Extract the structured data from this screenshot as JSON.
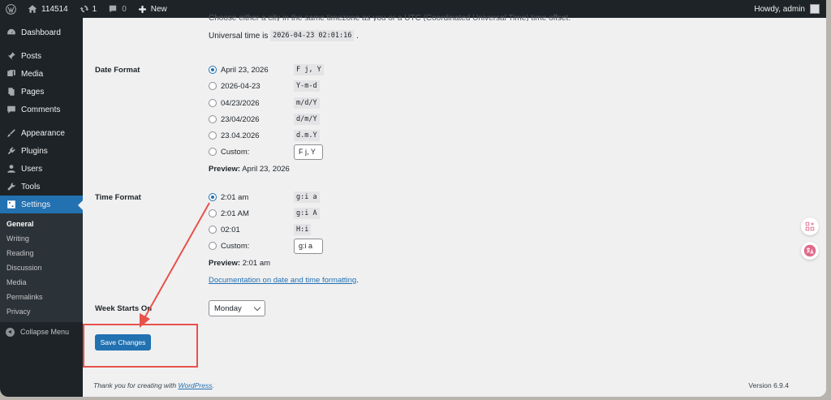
{
  "admin_bar": {
    "site_name": "114514",
    "updates_count": "1",
    "comments_count": "0",
    "new_label": "New",
    "greeting": "Howdy, admin"
  },
  "sidebar": {
    "items": [
      {
        "label": "Dashboard",
        "icon": "dashboard-icon"
      },
      {
        "label": "Posts",
        "icon": "pin-icon"
      },
      {
        "label": "Media",
        "icon": "media-icon"
      },
      {
        "label": "Pages",
        "icon": "page-icon"
      },
      {
        "label": "Comments",
        "icon": "comment-icon"
      },
      {
        "label": "Appearance",
        "icon": "brush-icon"
      },
      {
        "label": "Plugins",
        "icon": "plugin-icon"
      },
      {
        "label": "Users",
        "icon": "user-icon"
      },
      {
        "label": "Tools",
        "icon": "wrench-icon"
      },
      {
        "label": "Settings",
        "icon": "settings-icon"
      }
    ],
    "submenu": [
      "General",
      "Writing",
      "Reading",
      "Discussion",
      "Media",
      "Permalinks",
      "Privacy"
    ],
    "collapse_label": "Collapse Menu"
  },
  "timezone": {
    "clipped_text": "Choose either a city in the same timezone as you or a UTC (Coordinated Universal Time) time offset.",
    "universal_prefix": "Universal time is",
    "universal_value": "2026-04-23 02:01:16",
    "universal_suffix": "."
  },
  "date_format": {
    "label": "Date Format",
    "options": [
      {
        "label": "April 23, 2026",
        "code": "F j, Y",
        "checked": true
      },
      {
        "label": "2026-04-23",
        "code": "Y-m-d",
        "checked": false
      },
      {
        "label": "04/23/2026",
        "code": "m/d/Y",
        "checked": false
      },
      {
        "label": "23/04/2026",
        "code": "d/m/Y",
        "checked": false
      },
      {
        "label": "23.04.2026",
        "code": "d.m.Y",
        "checked": false
      }
    ],
    "custom_label": "Custom:",
    "custom_value": "F j, Y",
    "preview_label": "Preview:",
    "preview_value": "April 23, 2026"
  },
  "time_format": {
    "label": "Time Format",
    "options": [
      {
        "label": "2:01 am",
        "code": "g:i a",
        "checked": true
      },
      {
        "label": "2:01 AM",
        "code": "g:i A",
        "checked": false
      },
      {
        "label": "02:01",
        "code": "H:i",
        "checked": false
      }
    ],
    "custom_label": "Custom:",
    "custom_value": "g:i a",
    "preview_label": "Preview:",
    "preview_value": "2:01 am",
    "doc_link": "Documentation on date and time formatting",
    "doc_suffix": "."
  },
  "week": {
    "label": "Week Starts On",
    "selected": "Monday"
  },
  "save_label": "Save Changes",
  "footer": {
    "thanks_prefix": "Thank you for creating with",
    "thanks_link": "WordPress",
    "thanks_suffix": ".",
    "version": "Version 6.9.4"
  },
  "colors": {
    "accent": "#2271b1",
    "annotation": "#e9514b",
    "admin_bg": "#1d2327"
  }
}
